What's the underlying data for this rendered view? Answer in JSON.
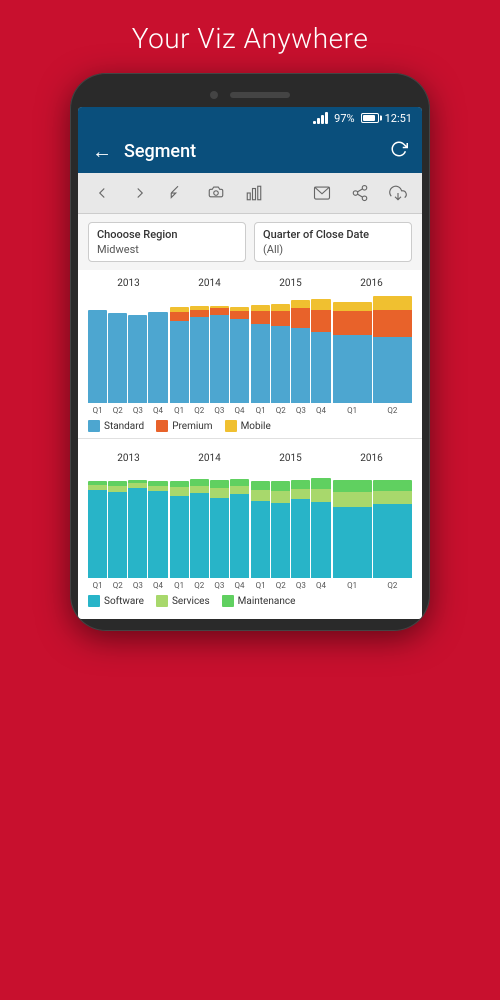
{
  "page": {
    "header": "Your Viz Anywhere",
    "app_bar": {
      "title": "Segment",
      "back_label": "←",
      "refresh_label": "↻"
    },
    "status_bar": {
      "battery": "97%",
      "time": "12:51"
    },
    "toolbar": {
      "buttons": [
        "←",
        "→",
        "|←",
        "📷",
        "📊",
        "✉+",
        "⋮",
        "⬇"
      ]
    },
    "filters": [
      {
        "label": "Chooose Region",
        "value": "Midwest"
      },
      {
        "label": "Quarter of Close Date",
        "value": "(All)"
      }
    ],
    "chart1": {
      "years": [
        "2013",
        "2014",
        "2015",
        "2016"
      ],
      "quarters": [
        "Q1",
        "Q2",
        "Q3",
        "Q4"
      ],
      "legend": [
        {
          "label": "Standard",
          "color": "standard"
        },
        {
          "label": "Premium",
          "color": "premium"
        },
        {
          "label": "Mobile",
          "color": "mobile"
        }
      ],
      "bars": [
        {
          "standard": 85,
          "premium": 0,
          "mobile": 0
        },
        {
          "standard": 82,
          "premium": 0,
          "mobile": 0
        },
        {
          "standard": 80,
          "premium": 0,
          "mobile": 0
        },
        {
          "standard": 83,
          "premium": 0,
          "mobile": 0
        },
        {
          "standard": 75,
          "premium": 8,
          "mobile": 4
        },
        {
          "standard": 78,
          "premium": 7,
          "mobile": 3
        },
        {
          "standard": 80,
          "premium": 6,
          "mobile": 2
        },
        {
          "standard": 76,
          "premium": 8,
          "mobile": 3
        },
        {
          "standard": 72,
          "premium": 12,
          "mobile": 5
        },
        {
          "standard": 70,
          "premium": 14,
          "mobile": 6
        },
        {
          "standard": 68,
          "premium": 18,
          "mobile": 8
        },
        {
          "standard": 65,
          "premium": 20,
          "mobile": 10
        },
        {
          "standard": 62,
          "premium": 22,
          "mobile": 8
        },
        {
          "standard": 60,
          "premium": 25,
          "mobile": 12
        }
      ]
    },
    "chart2": {
      "years": [
        "2013",
        "2014",
        "2015",
        "2016"
      ],
      "legend": [
        {
          "label": "Software",
          "color": "software"
        },
        {
          "label": "Services",
          "color": "services"
        },
        {
          "label": "Maintenance",
          "color": "maintenance"
        }
      ],
      "bars": [
        {
          "software": 80,
          "services": 5,
          "maintenance": 3
        },
        {
          "software": 78,
          "services": 6,
          "maintenance": 4
        },
        {
          "software": 82,
          "services": 4,
          "maintenance": 3
        },
        {
          "software": 79,
          "services": 5,
          "maintenance": 4
        },
        {
          "software": 75,
          "services": 8,
          "maintenance": 5
        },
        {
          "software": 77,
          "services": 7,
          "maintenance": 6
        },
        {
          "software": 73,
          "services": 9,
          "maintenance": 7
        },
        {
          "software": 76,
          "services": 8,
          "maintenance": 6
        },
        {
          "software": 70,
          "services": 10,
          "maintenance": 8
        },
        {
          "software": 68,
          "services": 11,
          "maintenance": 9
        },
        {
          "software": 72,
          "services": 9,
          "maintenance": 8
        },
        {
          "software": 69,
          "services": 12,
          "maintenance": 10
        },
        {
          "software": 65,
          "services": 13,
          "maintenance": 11
        },
        {
          "software": 67,
          "services": 12,
          "maintenance": 10
        }
      ]
    }
  }
}
